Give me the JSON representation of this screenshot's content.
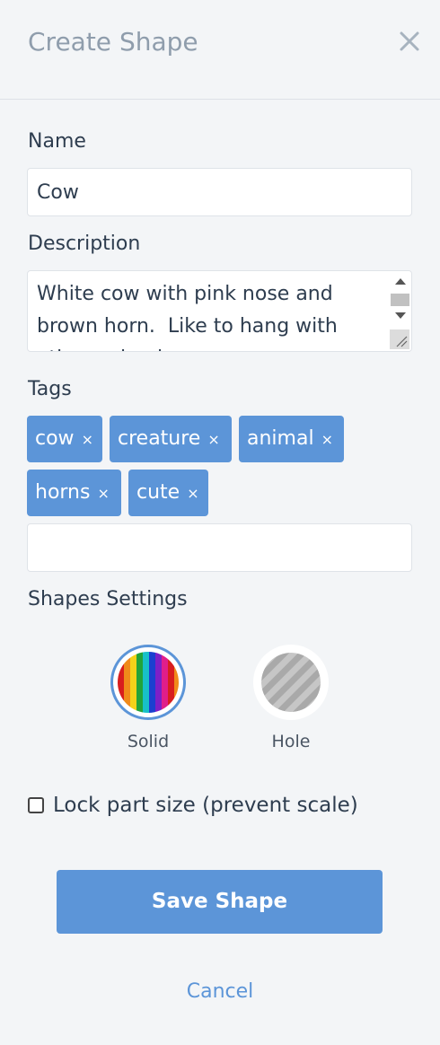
{
  "header": {
    "title": "Create Shape",
    "close_icon": "close-icon"
  },
  "name": {
    "label": "Name",
    "value": "Cow"
  },
  "description": {
    "label": "Description",
    "value": "White cow with pink nose and\nbrown horn.  Like to hang with\nother animals."
  },
  "tags": {
    "label": "Tags",
    "items": [
      {
        "label": "cow",
        "remove": "×"
      },
      {
        "label": "creature",
        "remove": "×"
      },
      {
        "label": "animal",
        "remove": "×"
      },
      {
        "label": "horns",
        "remove": "×"
      },
      {
        "label": "cute",
        "remove": "×"
      }
    ],
    "input_value": ""
  },
  "settings": {
    "label": "Shapes Settings",
    "options": [
      {
        "label": "Solid",
        "selected": true,
        "icon": "rainbow-stripes-icon"
      },
      {
        "label": "Hole",
        "selected": false,
        "icon": "gray-stripes-icon"
      }
    ]
  },
  "lock": {
    "label": "Lock part size (prevent scale)",
    "checked": false
  },
  "actions": {
    "save_label": "Save Shape",
    "cancel_label": "Cancel"
  },
  "colors": {
    "accent": "#5c95d8",
    "title_gray": "#8f9dac",
    "text": "#2e3d4f",
    "background": "#f3f5f7"
  }
}
